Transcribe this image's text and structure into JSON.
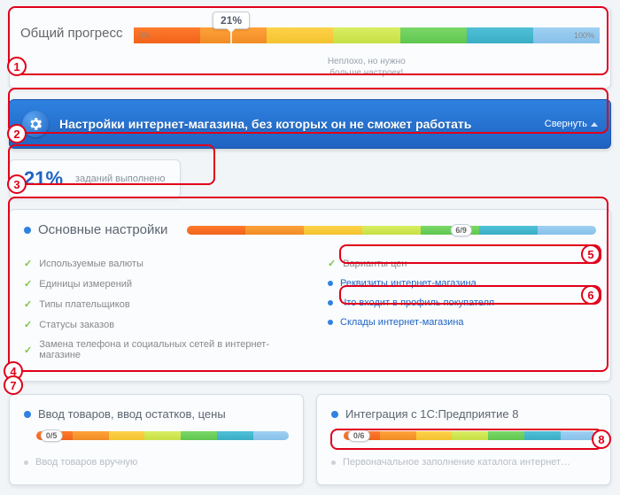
{
  "colors": {
    "accent": "#2f82e0",
    "danger": "#e1001a",
    "success": "#7ec245"
  },
  "overall": {
    "title": "Общий прогресс",
    "min_label": "0%",
    "max_label": "100%",
    "value_pct": 21,
    "marker_label": "21%",
    "caption_line1": "Неплохо, но нужно",
    "caption_line2": "больше настроек!"
  },
  "banner": {
    "title": "Настройки интернет-магазина, без которых он не сможет работать",
    "collapse_label": "Свернуть"
  },
  "pill": {
    "percent": "21%",
    "caption": "заданий выполнено"
  },
  "main_section": {
    "title": "Основные настройки",
    "done": 6,
    "total": 9,
    "badge": "6/9",
    "badge_pos_pct": 67,
    "left_items": [
      {
        "done": true,
        "label": "Используемые валюты"
      },
      {
        "done": true,
        "label": "Единицы измерений"
      },
      {
        "done": true,
        "label": "Типы плательщиков"
      },
      {
        "done": true,
        "label": "Статусы заказов"
      },
      {
        "done": true,
        "label": "Замена телефона и социальных сетей в интернет-магазине"
      }
    ],
    "right_items": [
      {
        "done": true,
        "label": "Варианты цен"
      },
      {
        "done": false,
        "label": "Реквизиты интернет-магазина"
      },
      {
        "done": false,
        "label": "Что входит в профиль покупателя"
      },
      {
        "done": false,
        "label": "Склады интернет-магазина"
      }
    ]
  },
  "bottom_left": {
    "title": "Ввод товаров, ввод остатков, цены",
    "done": 0,
    "total": 5,
    "badge": "0/5",
    "badge_pos_pct": 6,
    "muted_item": "Ввод товаров вручную"
  },
  "bottom_right": {
    "title": "Интеграция с 1С:Предприятие 8",
    "done": 0,
    "total": 6,
    "badge": "0/6",
    "badge_pos_pct": 6,
    "muted_item": "Первоначальное заполнение каталога интернет…"
  },
  "annotations": {
    "1": "overall-progress",
    "2": "required-settings-banner",
    "3": "tasks-done-pill",
    "4": "main-settings-section",
    "5": "price-variants-row",
    "6": "buyer-profile-row",
    "7": "bottom-left-section",
    "8": "1c-progress-bar"
  }
}
